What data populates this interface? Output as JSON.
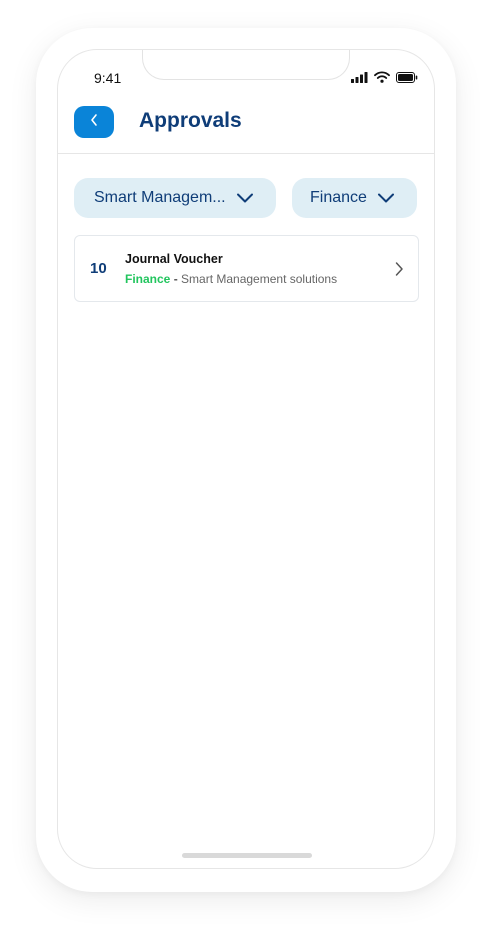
{
  "status_bar": {
    "time": "9:41",
    "icons": [
      "signal-icon",
      "wifi-icon",
      "battery-icon"
    ]
  },
  "header": {
    "back_icon": "chevron-left-icon",
    "title": "Approvals"
  },
  "filters": {
    "company": {
      "label": "Smart Managem...",
      "icon": "chevron-down-icon"
    },
    "department": {
      "label": "Finance",
      "icon": "chevron-down-icon"
    }
  },
  "approvals": [
    {
      "count": "10",
      "title": "Journal Voucher",
      "department": "Finance",
      "separator": " - ",
      "company": "Smart Management solutions",
      "icon": "chevron-right-icon"
    }
  ],
  "colors": {
    "accent": "#0a84d8",
    "title": "#0f3d78",
    "chip_bg": "#dfeef5",
    "department_text": "#22c55e"
  }
}
